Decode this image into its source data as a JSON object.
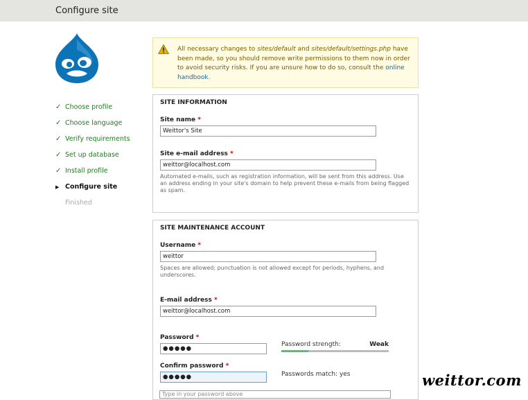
{
  "header": {
    "title": "Configure site"
  },
  "logo": {
    "icon": "drupal-drop-logo"
  },
  "steps": [
    {
      "label": "Choose profile",
      "status": "done"
    },
    {
      "label": "Choose language",
      "status": "done"
    },
    {
      "label": "Verify requirements",
      "status": "done"
    },
    {
      "label": "Set up database",
      "status": "done"
    },
    {
      "label": "Install profile",
      "status": "done"
    },
    {
      "label": "Configure site",
      "status": "active"
    },
    {
      "label": "Finished",
      "status": "pending"
    }
  ],
  "warning": {
    "icon": "warning-triangle-icon",
    "part1": "All necessary changes to ",
    "path1": "sites/default",
    "part2": " and ",
    "path2": "sites/default/settings.php",
    "part3": " have been made, so you should remove write permissions to them now in order to avoid security risks. If you are unsure how to do so, consult the ",
    "link": "online handbook",
    "part4": "."
  },
  "site_info": {
    "legend": "SITE INFORMATION",
    "site_name_label": "Site name",
    "site_name_value": "Weittor's Site",
    "email_label": "Site e-mail address",
    "email_value": "weittor@localhost.com",
    "email_desc": "Automated e-mails, such as registration information, will be sent from this address. Use an address ending in your site's domain to help prevent these e-mails from being flagged as spam."
  },
  "maintenance": {
    "legend": "SITE MAINTENANCE ACCOUNT",
    "username_label": "Username",
    "username_value": "weittor",
    "username_desc": "Spaces are allowed; punctuation is not allowed except for periods, hyphens, and underscores.",
    "email_label": "E-mail address",
    "email_value": "weittor@localhost.com",
    "password_label": "Password",
    "password_value": "●●●●●",
    "confirm_label": "Confirm password",
    "confirm_value": "●●●●●",
    "strength_label": "Password strength:",
    "strength_value": "Weak",
    "strength_level": 0.25,
    "match_text": "Passwords match: yes"
  },
  "required_marker": "*",
  "next_field_partial": "Type in your password above",
  "watermark": "weittor.com",
  "colors": {
    "done": "#1d7c1d",
    "warning_bg": "#fffce3",
    "link": "#0f6aa6",
    "required": "#cc0000",
    "strength_fill": "#47c965"
  }
}
